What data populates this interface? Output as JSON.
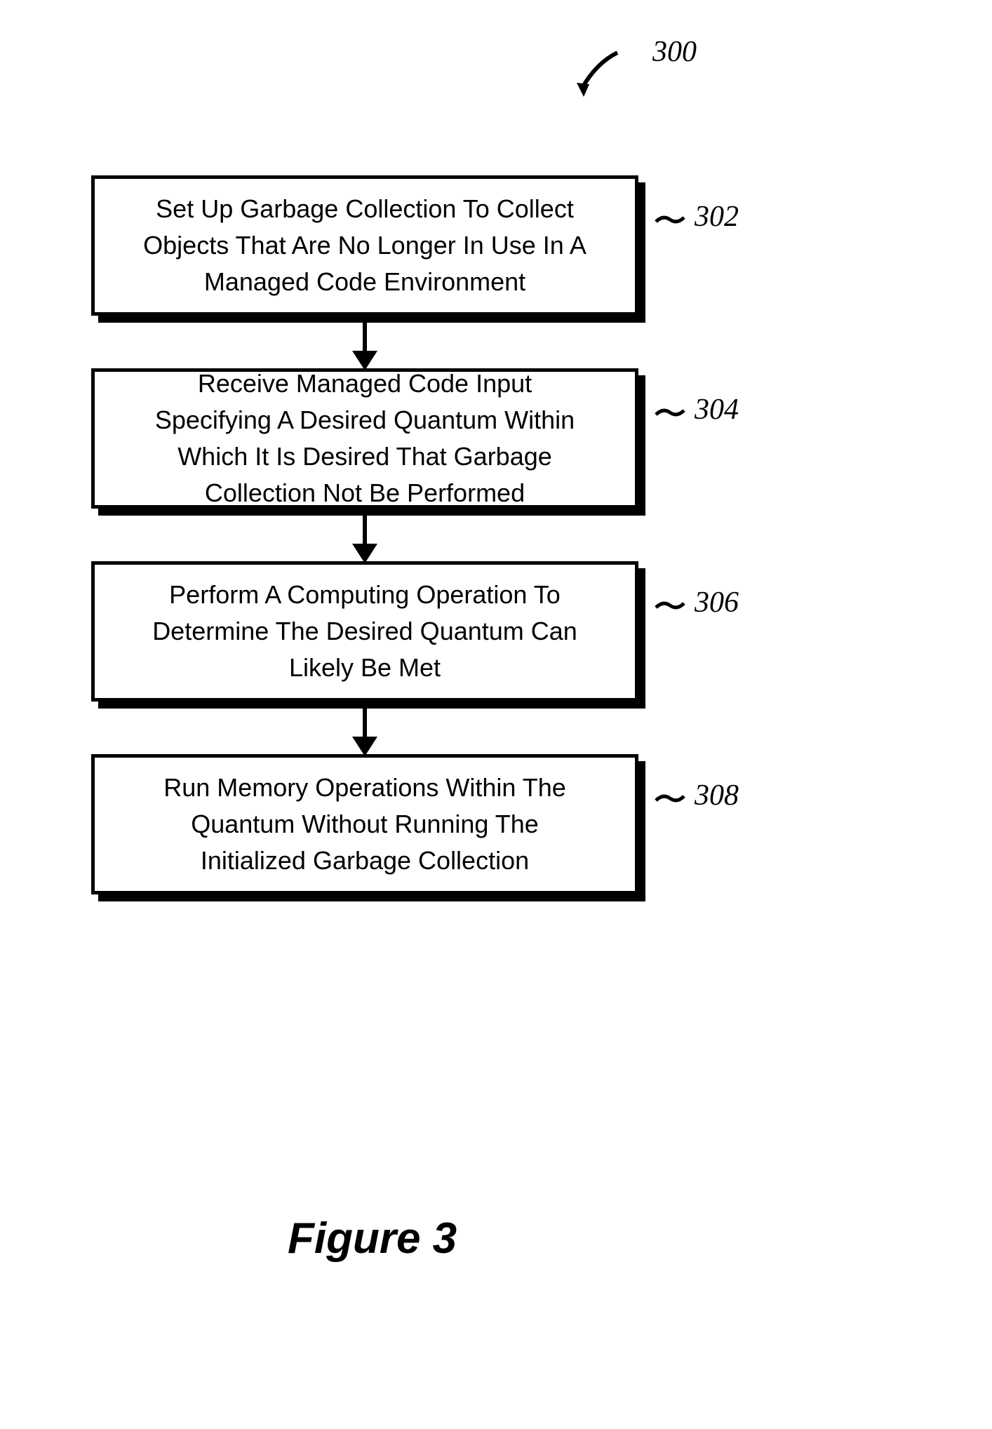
{
  "figure": {
    "label": "Figure 3",
    "ref_main": "300"
  },
  "steps": [
    {
      "ref": "302",
      "text": "Set Up Garbage Collection To Collect Objects That Are No Longer In Use In A Managed Code Environment"
    },
    {
      "ref": "304",
      "text": "Receive Managed Code Input Specifying A Desired Quantum Within Which It Is Desired That Garbage Collection Not Be Performed"
    },
    {
      "ref": "306",
      "text": "Perform A Computing Operation To Determine The Desired Quantum Can Likely Be Met"
    },
    {
      "ref": "308",
      "text": "Run Memory Operations Within The Quantum Without Running The Initialized Garbage Collection"
    }
  ]
}
